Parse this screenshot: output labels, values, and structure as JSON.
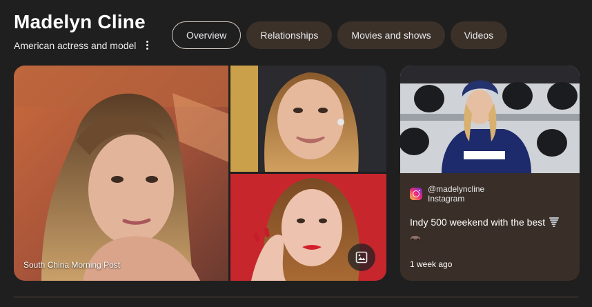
{
  "entity": {
    "name": "Madelyn Cline",
    "description": "American actress and model"
  },
  "tabs": [
    {
      "label": "Overview",
      "active": true
    },
    {
      "label": "Relationships",
      "active": false
    },
    {
      "label": "Movies and shows",
      "active": false
    },
    {
      "label": "Videos",
      "active": false
    }
  ],
  "images": {
    "main_source": "South China Morning Post",
    "gallery_icon": "image-gallery-icon"
  },
  "social_card": {
    "platform_icon": "instagram-icon",
    "handle": "@madelyncline",
    "platform": "Instagram",
    "post_text": "Indy 500 weekend with the best",
    "time": "1 week ago"
  },
  "colors": {
    "background": "#1f1f1f",
    "tab_bg": "#3c3129",
    "card_bg": "#3a2f28",
    "active_tab_border": "#d6cbc2"
  }
}
